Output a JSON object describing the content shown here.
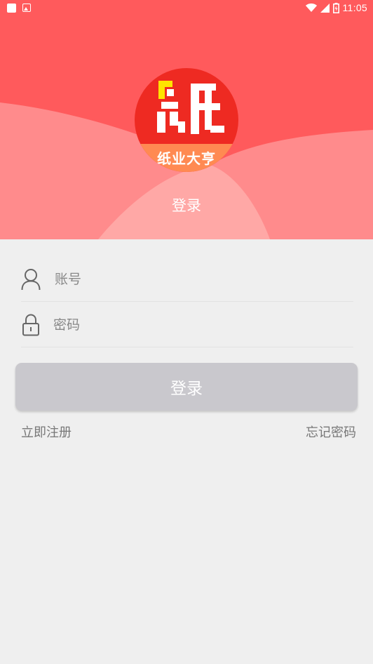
{
  "status_bar": {
    "time": "11:05"
  },
  "colors": {
    "header_bg": "#ff5a5c",
    "wave_light": "#ff8b8c",
    "wave_center": "#ffa8a6",
    "logo_red": "#ee2a22",
    "logo_band": "#ff8a52",
    "logo_yellow": "#ffe400",
    "button_bg": "#c9c8cd",
    "page_bg": "#efefef"
  },
  "logo": {
    "text": "纸业大亨"
  },
  "header": {
    "title": "登录"
  },
  "form": {
    "account": {
      "icon": "user-icon",
      "placeholder": "账号",
      "value": ""
    },
    "password": {
      "icon": "lock-icon",
      "placeholder": "密码",
      "value": ""
    },
    "login_label": "登录"
  },
  "links": {
    "register": "立即注册",
    "forgot": "忘记密码"
  }
}
